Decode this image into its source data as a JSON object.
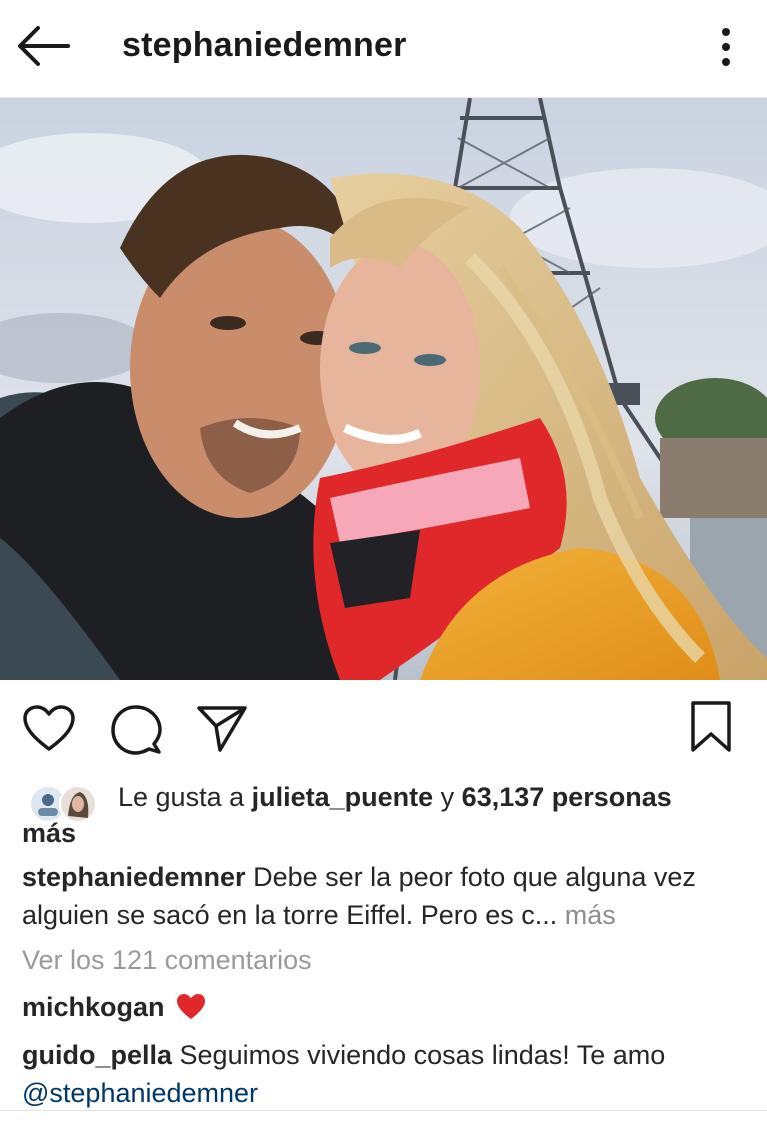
{
  "header": {
    "username": "stephaniedemner",
    "back_icon": "arrow-left-icon",
    "more_icon": "vertical-dots-icon"
  },
  "post": {
    "image_alt": "Selfie de pareja frente a la Torre Eiffel",
    "actions": {
      "like_icon": "heart-icon",
      "comment_icon": "comment-bubble-icon",
      "share_icon": "paper-plane-icon",
      "save_icon": "bookmark-icon"
    },
    "likes": {
      "prefix": "Le gusta a ",
      "user": "julieta_puente",
      "connector": " y ",
      "count_text": "63,137 personas",
      "suffix": "más"
    },
    "caption": {
      "username": "stephaniedemner",
      "text": " Debe ser la peor foto que alguna vez alguien se sacó en la torre Eiffel. Pero es c...",
      "more": " más"
    },
    "view_comments": "Ver los 121 comentarios",
    "comments": [
      {
        "username": "michkogan",
        "text": "",
        "emoji": "heart-emoji"
      },
      {
        "username": "guido_pella",
        "text": " Seguimos viviendo cosas lindas! Te amo ",
        "mention": "@stephaniedemner"
      }
    ]
  },
  "colors": {
    "text": "#262626",
    "muted": "#8e8e8e",
    "mention": "#00376b",
    "heart": "#ed4956"
  }
}
